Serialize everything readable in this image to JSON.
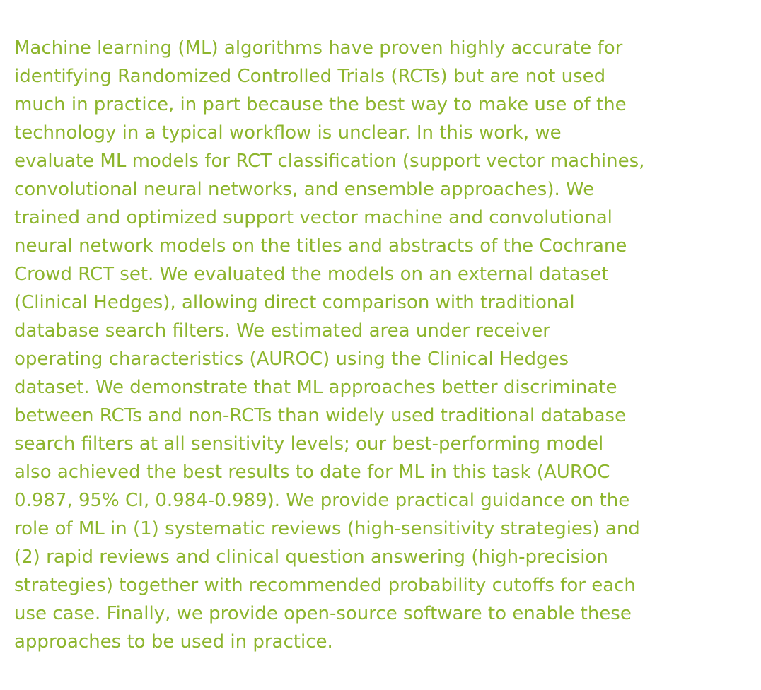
{
  "abstract": {
    "lines": [
      "Machine learning (ML) algorithms have proven highly accurate for",
      "identifying Randomized Controlled Trials (RCTs) but are not used",
      "much in practice, in part because the best way to make use of the",
      "technology in a typical workflow is unclear. In this work, we",
      "evaluate ML models for RCT classification (support vector machines,",
      "convolutional neural networks, and ensemble approaches). We",
      "trained and optimized support vector machine and convolutional",
      "neural network models on the titles and abstracts of the Cochrane",
      "Crowd RCT set. We evaluated the models on an external dataset",
      "(Clinical Hedges), allowing direct comparison with traditional",
      "database search filters. We estimated area under receiver",
      "operating characteristics (AUROC) using the Clinical Hedges",
      "dataset. We demonstrate that ML approaches better discriminate",
      "between RCTs and non-RCTs than widely used traditional database",
      "search filters at all sensitivity levels; our best-performing model",
      "also achieved the best results to date for ML in this task (AUROC",
      "0.987, 95% CI, 0.984-0.989). We provide practical guidance on the",
      "role of ML in (1) systematic reviews (high-sensitivity strategies) and",
      "(2) rapid reviews and clinical question answering (high-precision",
      "strategies) together with recommended probability cutoffs for each",
      "use case. Finally, we provide open-source software to enable these",
      "approaches to be used in practice."
    ],
    "text_color": "#8db52d"
  }
}
